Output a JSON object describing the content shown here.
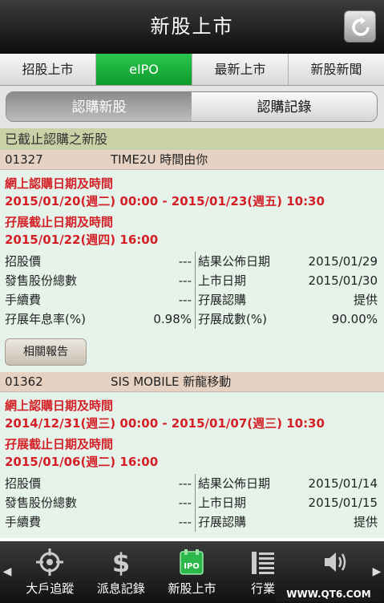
{
  "title": "新股上市",
  "tabs": [
    {
      "label": "招股上市"
    },
    {
      "label": "eIPO"
    },
    {
      "label": "最新上市"
    },
    {
      "label": "新股新聞"
    }
  ],
  "segments": {
    "subscribe": "認購新股",
    "records": "認購記錄"
  },
  "section_title": "已截止認購之新股",
  "stocks": [
    {
      "code": "01327",
      "name": "TIME2U 時間由你",
      "online_label": "網上認購日期及時間",
      "online_value": "2015/01/20(週二) 00:00 - 2015/01/23(週五) 10:30",
      "margin_label": "孖展截止日期及時間",
      "margin_value": "2015/01/22(週四) 16:00",
      "rows": [
        {
          "l_label": "招股價",
          "l_value": "---",
          "r_label": "結果公佈日期",
          "r_value": "2015/01/29"
        },
        {
          "l_label": "發售股份總數",
          "l_value": "---",
          "r_label": "上市日期",
          "r_value": "2015/01/30"
        },
        {
          "l_label": "手續費",
          "l_value": "---",
          "r_label": "孖展認購",
          "r_value": "提供"
        },
        {
          "l_label": "孖展年息率(%)",
          "l_value": "0.98%",
          "r_label": "孖展成數(%)",
          "r_value": "90.00%"
        }
      ],
      "report_label": "相關報告"
    },
    {
      "code": "01362",
      "name": "SIS MOBILE 新龍移動",
      "online_label": "網上認購日期及時間",
      "online_value": "2014/12/31(週三) 00:00 - 2015/01/07(週三) 10:30",
      "margin_label": "孖展截止日期及時間",
      "margin_value": "2015/01/06(週二) 16:00",
      "rows": [
        {
          "l_label": "招股價",
          "l_value": "---",
          "r_label": "結果公佈日期",
          "r_value": "2015/01/14"
        },
        {
          "l_label": "發售股份總數",
          "l_value": "---",
          "r_label": "上市日期",
          "r_value": "2015/01/15"
        },
        {
          "l_label": "手續費",
          "l_value": "---",
          "r_label": "孖展認購",
          "r_value": "提供"
        }
      ]
    }
  ],
  "bottom_nav": [
    {
      "label": "大戶追蹤",
      "icon": "crosshair-icon"
    },
    {
      "label": "派息記錄",
      "icon": "dollar-icon"
    },
    {
      "label": "新股上市",
      "icon": "ipo-icon"
    },
    {
      "label": "行業",
      "icon": "list-icon"
    }
  ],
  "watermark": "WWW.QT6.COM",
  "colors": {
    "accent_green": "#1aae3b",
    "red": "#d41f26",
    "stock_head": "#e6d2c2",
    "stock_body": "#e5f3ea",
    "section": "#c9d1a6"
  }
}
